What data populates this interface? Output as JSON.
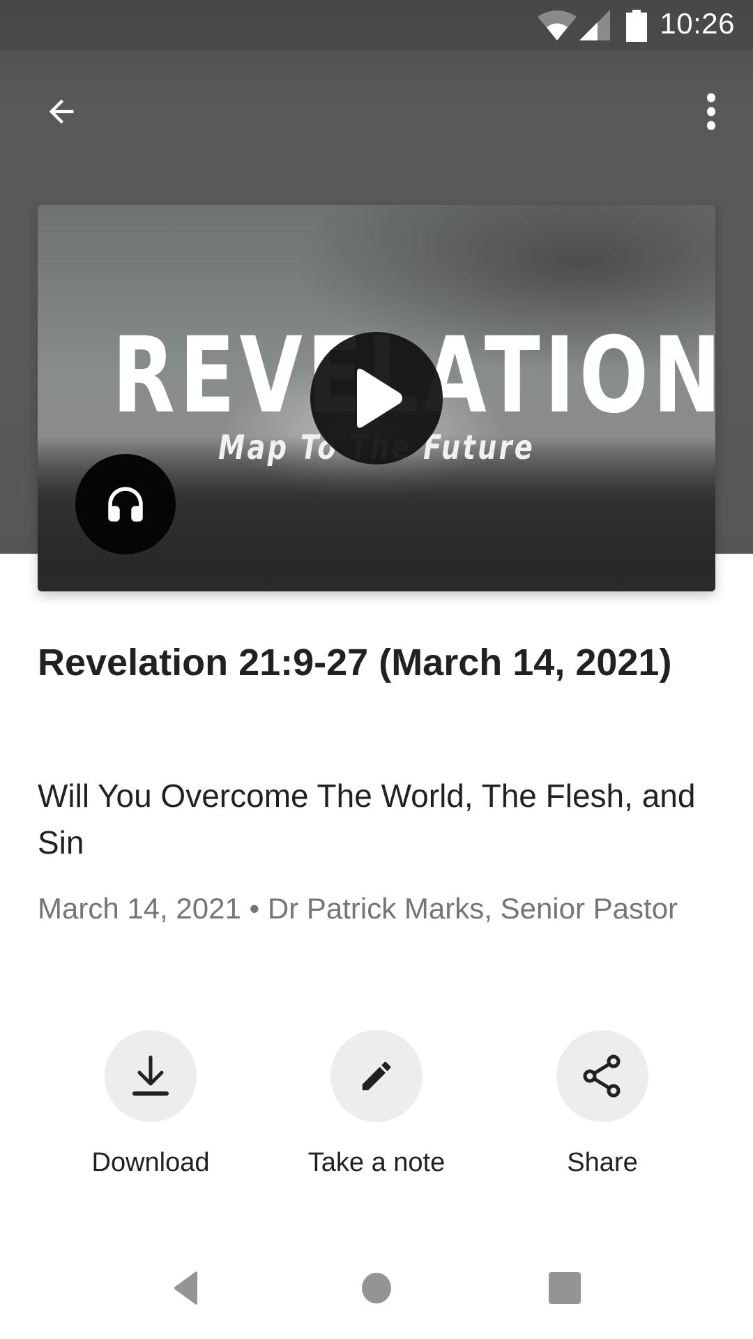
{
  "status_bar": {
    "time": "10:26",
    "icons": [
      "wifi-icon",
      "cell-signal-icon",
      "battery-icon"
    ]
  },
  "app_bar": {
    "back_icon": "arrow-back-icon",
    "more_icon": "more-vertical-icon"
  },
  "media": {
    "artwork_title": "REVELATION",
    "artwork_subtitle": "Map To The Future",
    "play_icon": "play-icon",
    "audio_icon": "headphones-icon"
  },
  "sermon": {
    "title": "Revelation 21:9-27 (March 14, 2021)",
    "subtitle": "Will You Overcome The World, The Flesh, and Sin",
    "meta": "March 14, 2021 • Dr Patrick Marks, Senior Pastor"
  },
  "actions": [
    {
      "label": "Download",
      "icon": "download-icon"
    },
    {
      "label": "Take a note",
      "icon": "pencil-icon"
    },
    {
      "label": "Share",
      "icon": "share-icon"
    }
  ],
  "nav_bar": {
    "buttons": [
      "nav-back-icon",
      "nav-home-icon",
      "nav-recents-icon"
    ]
  },
  "colors": {
    "header_bg": "#595857",
    "action_bg": "#eceded",
    "text_primary": "#212121",
    "text_secondary": "#757575",
    "nav_icon": "#949494"
  }
}
